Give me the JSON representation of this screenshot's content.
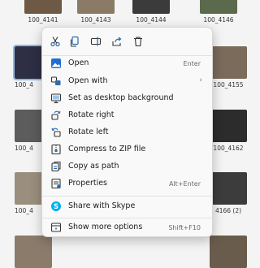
{
  "files": [
    {
      "label": "100_4141",
      "color": "#6e5a44"
    },
    {
      "label": "100_4143",
      "color": "#8a7a66"
    },
    {
      "label": "100_4144",
      "color": "#3b3b3b"
    },
    {
      "label": "100_4146",
      "color": "#5b6a4d"
    },
    {
      "label": "100_4",
      "color": "#2e2e44",
      "selected": true
    },
    {
      "label": "100_4155",
      "color": "#7a6b5b"
    },
    {
      "label": "100_4",
      "color": "#5c5c5c"
    },
    {
      "label": "100_4162",
      "color": "#2c2c2c"
    },
    {
      "label": "100_4",
      "color": "#9a8e7e"
    },
    {
      "label": "4166 (2)",
      "color": "#3c3c3c"
    }
  ],
  "quick_actions": [
    {
      "name": "cut-button",
      "icon": "scissors-icon"
    },
    {
      "name": "copy-button",
      "icon": "copy-icon"
    },
    {
      "name": "rename-button",
      "icon": "rename-icon"
    },
    {
      "name": "share-button",
      "icon": "share-icon"
    },
    {
      "name": "delete-button",
      "icon": "trash-icon"
    }
  ],
  "menu": {
    "open": {
      "label": "Open",
      "shortcut": "Enter",
      "icon": "photos-app-icon"
    },
    "open_with": {
      "label": "Open with",
      "icon": "open-with-icon",
      "submenu_glyph": "›"
    },
    "set_background": {
      "label": "Set as desktop background",
      "icon": "desktop-icon"
    },
    "rotate_right": {
      "label": "Rotate right",
      "icon": "rotate-right-icon"
    },
    "rotate_left": {
      "label": "Rotate left",
      "icon": "rotate-left-icon"
    },
    "compress": {
      "label": "Compress to ZIP file",
      "icon": "zip-icon"
    },
    "copy_path": {
      "label": "Copy as path",
      "icon": "copy-path-icon"
    },
    "properties": {
      "label": "Properties",
      "shortcut": "Alt+Enter",
      "icon": "properties-icon"
    },
    "share_skype": {
      "label": "Share with Skype",
      "icon": "skype-icon"
    },
    "show_more": {
      "label": "Show more options",
      "shortcut": "Shift+F10",
      "icon": "more-options-icon"
    }
  },
  "colors": {
    "accent": "#0067c0",
    "icon_blue": "#2b6cb0",
    "skype": "#00aff0"
  }
}
